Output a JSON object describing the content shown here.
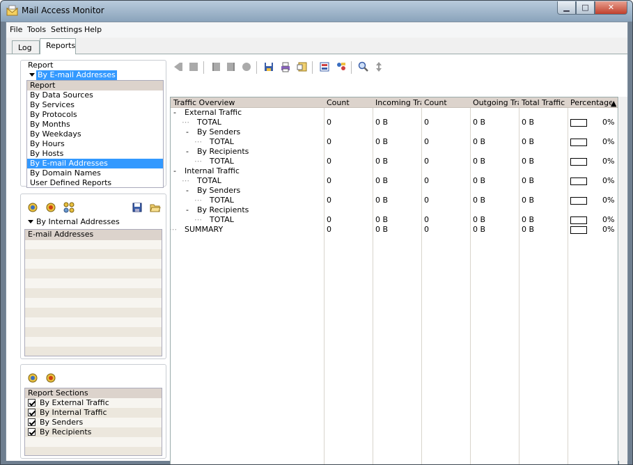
{
  "window": {
    "title": "Mail Access Monitor",
    "minimize_label": "▁",
    "maximize_label": "□",
    "close_label": "✕"
  },
  "menubar": {
    "items": [
      "File",
      "Tools",
      "Settings",
      "Help"
    ]
  },
  "tabs": [
    {
      "label": "Log"
    },
    {
      "label": "Reports"
    }
  ],
  "report_panel": {
    "label": "Report",
    "selected": "By E-mail Addresses",
    "list_header": "Report",
    "options": [
      "By Data Sources",
      "By Services",
      "By Protocols",
      "By Months",
      "By Weekdays",
      "By Hours",
      "By Hosts",
      "By E-mail Addresses",
      "By Domain Names",
      "User Defined Reports"
    ],
    "selected_index": 7
  },
  "address_panel": {
    "combo_label": "By Internal Addresses",
    "list_header": "E-mail Addresses"
  },
  "sections_panel": {
    "list_header": "Report Sections",
    "items": [
      {
        "label": "By External Traffic",
        "checked": true
      },
      {
        "label": "By Internal Traffic",
        "checked": true
      },
      {
        "label": "By Senders",
        "checked": true
      },
      {
        "label": "By Recipients",
        "checked": true
      }
    ]
  },
  "grid": {
    "columns": [
      "Traffic Overview",
      "Count",
      "Incoming Traf",
      "Count",
      "Outgoing Traf",
      "Total Traffic",
      "Percentage"
    ],
    "rows": [
      {
        "name": "External Traffic",
        "level": 0,
        "expander": "-",
        "values": null
      },
      {
        "name": "TOTAL",
        "level": 1,
        "expander": "",
        "values": [
          "0",
          "0 B",
          "0",
          "0 B",
          "0 B",
          "0%"
        ]
      },
      {
        "name": "By Senders",
        "level": 1,
        "expander": "-",
        "values": null
      },
      {
        "name": "TOTAL",
        "level": 2,
        "expander": "",
        "values": [
          "0",
          "0 B",
          "0",
          "0 B",
          "0 B",
          "0%"
        ]
      },
      {
        "name": "By Recipients",
        "level": 1,
        "expander": "-",
        "values": null
      },
      {
        "name": "TOTAL",
        "level": 2,
        "expander": "",
        "values": [
          "0",
          "0 B",
          "0",
          "0 B",
          "0 B",
          "0%"
        ]
      },
      {
        "name": "Internal Traffic",
        "level": 0,
        "expander": "-",
        "values": null
      },
      {
        "name": "TOTAL",
        "level": 1,
        "expander": "",
        "values": [
          "0",
          "0 B",
          "0",
          "0 B",
          "0 B",
          "0%"
        ]
      },
      {
        "name": "By Senders",
        "level": 1,
        "expander": "-",
        "values": null
      },
      {
        "name": "TOTAL",
        "level": 2,
        "expander": "",
        "values": [
          "0",
          "0 B",
          "0",
          "0 B",
          "0 B",
          "0%"
        ]
      },
      {
        "name": "By Recipients",
        "level": 1,
        "expander": "-",
        "values": null
      },
      {
        "name": "TOTAL",
        "level": 2,
        "expander": "",
        "values": [
          "0",
          "0 B",
          "0",
          "0 B",
          "0 B",
          "0%"
        ]
      },
      {
        "name": "SUMMARY",
        "level": 0,
        "expander": "",
        "values": [
          "0",
          "0 B",
          "0",
          "0 B",
          "0 B",
          "0%"
        ]
      }
    ]
  },
  "toolbar": {
    "icons": [
      "back-icon",
      "stop-icon",
      "prev-icon",
      "next-icon",
      "record-icon",
      "save-icon",
      "print-icon",
      "export-icon",
      "report-icon",
      "users-icon",
      "zoom-icon",
      "sort-icon"
    ]
  },
  "colors": {
    "selection": "#3399ff",
    "header": "#dcd3cc",
    "stripe": "#ece7dd"
  }
}
